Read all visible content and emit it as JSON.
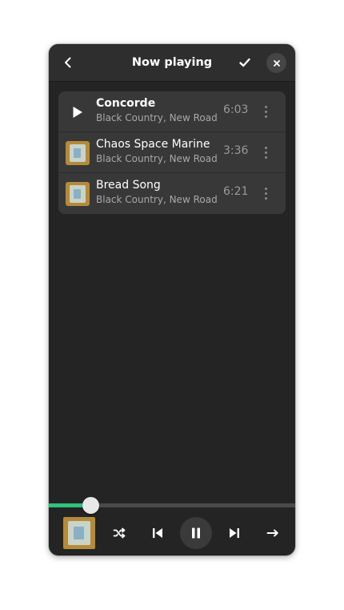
{
  "header": {
    "title": "Now playing",
    "back_icon": "chevron-left-icon",
    "confirm_icon": "checkmark-icon",
    "close_icon": "close-icon"
  },
  "playlist": [
    {
      "title": "Concorde",
      "artist": "Black Country, New Road",
      "duration": "6:03",
      "playing": true
    },
    {
      "title": "Chaos Space Marine",
      "artist": "Black Country, New Road",
      "duration": "3:36",
      "playing": false
    },
    {
      "title": "Bread Song",
      "artist": "Black Country, New Road",
      "duration": "6:21",
      "playing": false
    }
  ],
  "player": {
    "progress_fraction": 0.17,
    "accent_color": "#2ec27e",
    "shuffle_icon": "shuffle-icon",
    "previous_icon": "skip-previous-icon",
    "pause_icon": "pause-icon",
    "next_icon": "skip-next-icon",
    "repeat_icon": "arrow-right-icon"
  }
}
